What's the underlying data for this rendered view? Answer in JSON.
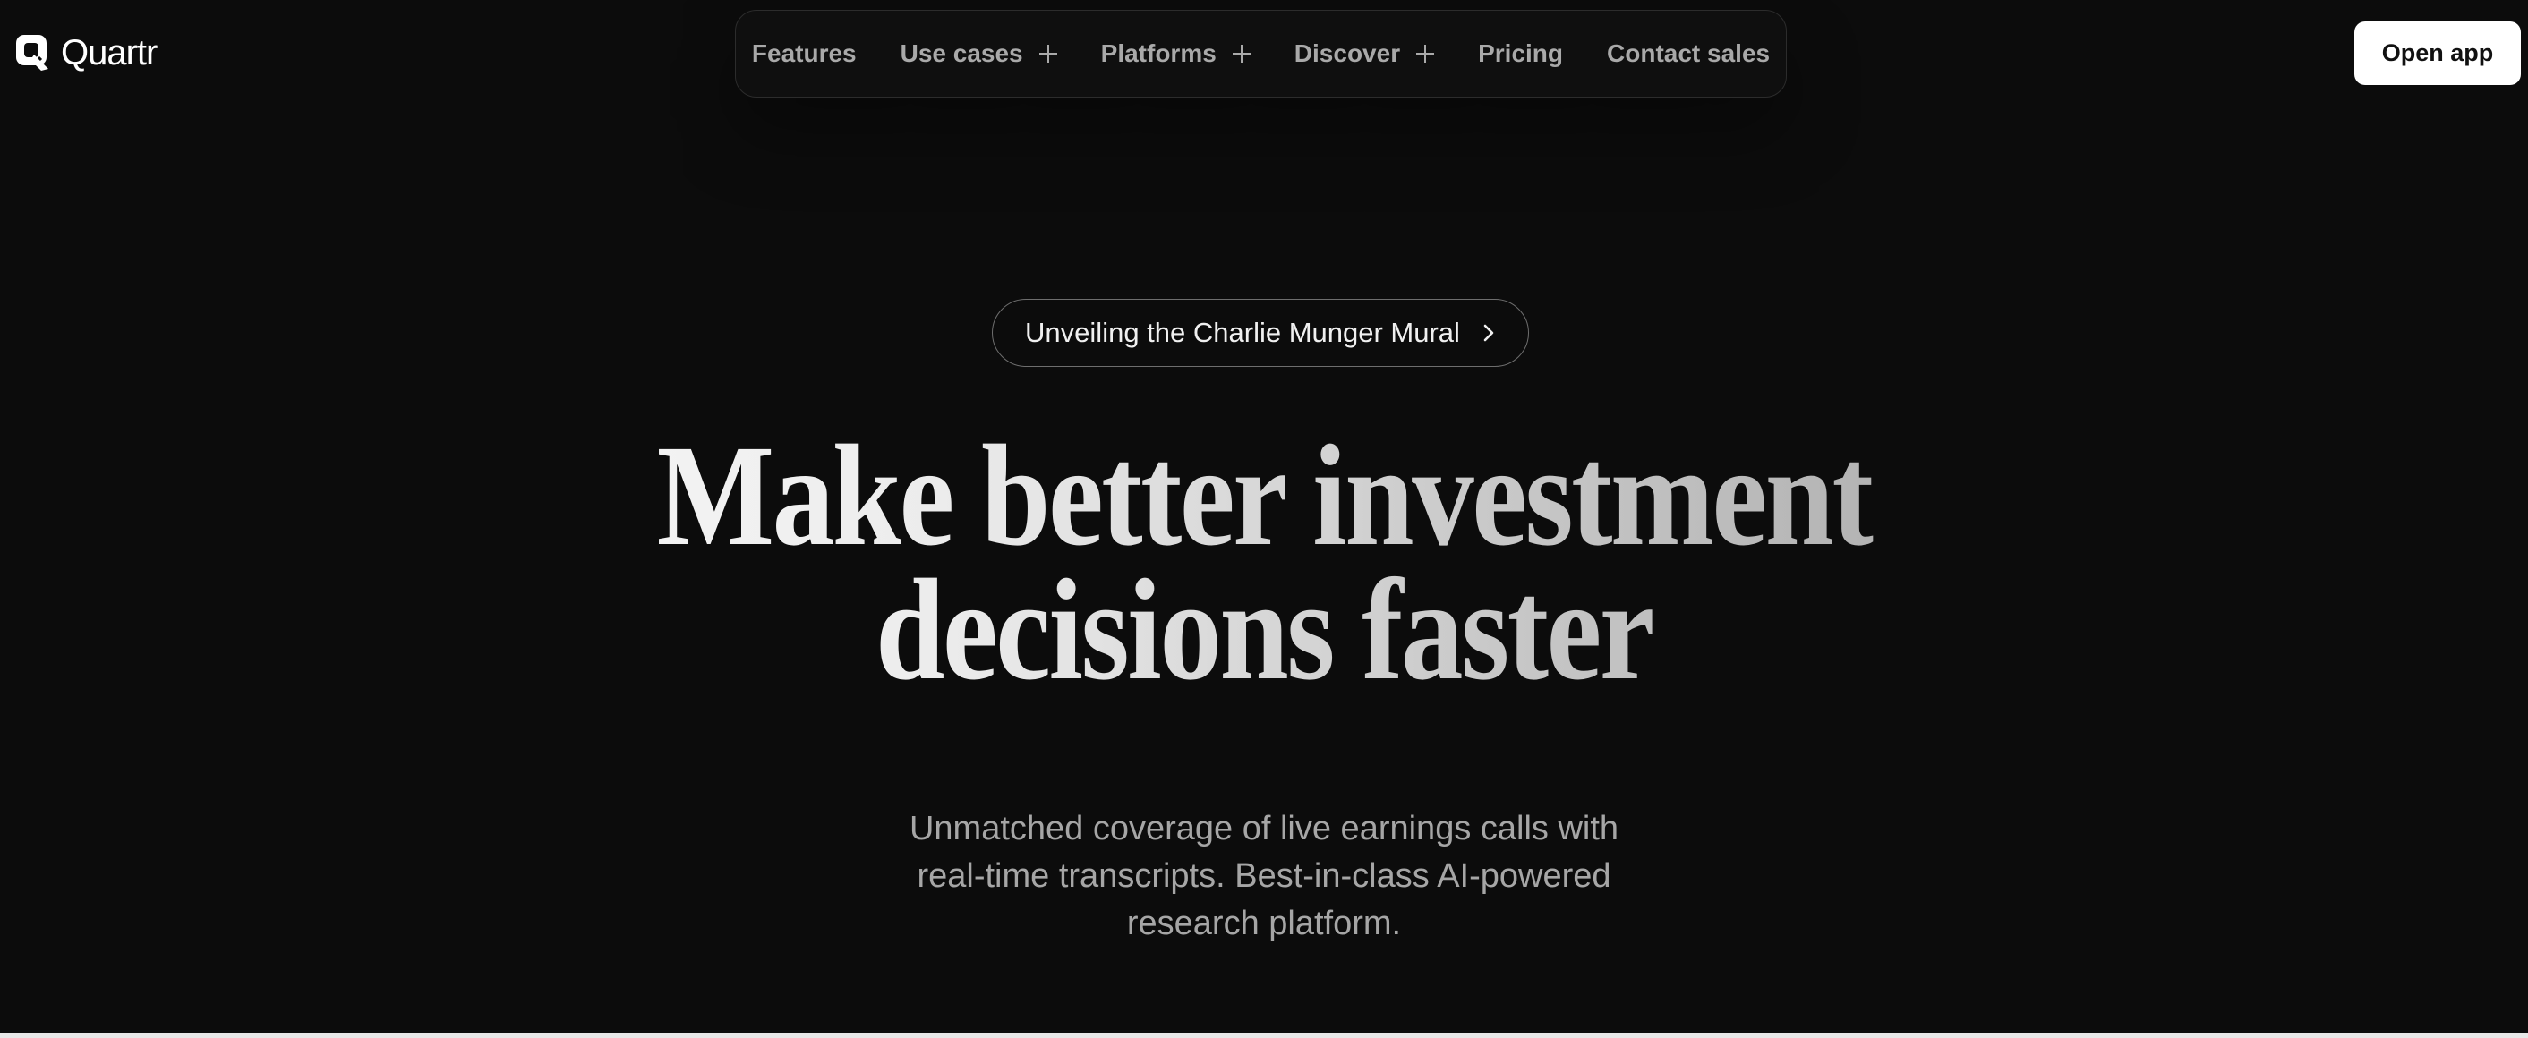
{
  "brand": {
    "name": "Quartr",
    "logo_icon": "quartr-logo-icon"
  },
  "nav": {
    "items": [
      {
        "label": "Features",
        "has_plus": false
      },
      {
        "label": "Use cases",
        "has_plus": true
      },
      {
        "label": "Platforms",
        "has_plus": true
      },
      {
        "label": "Discover",
        "has_plus": true
      },
      {
        "label": "Pricing",
        "has_plus": false
      },
      {
        "label": "Contact sales",
        "has_plus": false
      }
    ]
  },
  "header": {
    "open_app_label": "Open app"
  },
  "hero": {
    "announcement": "Unveiling the Charlie Munger Mural",
    "headline_line1": "Make better investment",
    "headline_line2": "decisions faster",
    "subtitle": "Unmatched coverage of live earnings calls with real-time transcripts. Best-in-class AI-powered research platform."
  },
  "colors": {
    "background": "#0c0c0c",
    "nav_text": "#a9a9a9",
    "button_bg": "#ffffff",
    "subtitle_text": "#a6a6a6"
  }
}
